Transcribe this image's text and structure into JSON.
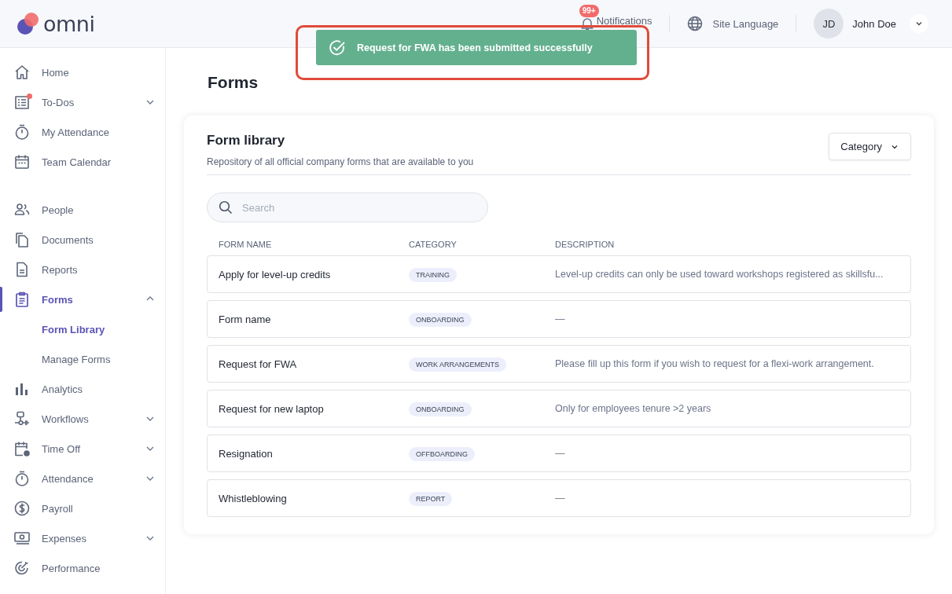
{
  "header": {
    "logo": "omni",
    "notifications": {
      "label": "Notifications",
      "badge": "99+"
    },
    "language": "Site Language",
    "user": {
      "initials": "JD",
      "name": "John Doe"
    }
  },
  "toast": {
    "message": "Request for FWA has been submitted successfully",
    "highlighted": true
  },
  "sidebar": {
    "groups": [
      [
        {
          "label": "Home",
          "selected": false,
          "expandable": false
        },
        {
          "label": "To-Dos",
          "selected": false,
          "expandable": true,
          "expanded": false,
          "alert": true
        },
        {
          "label": "My Attendance",
          "selected": false,
          "expandable": false
        },
        {
          "label": "Team Calendar",
          "selected": false,
          "expandable": false
        }
      ],
      [
        {
          "label": "People",
          "selected": false,
          "expandable": false
        },
        {
          "label": "Documents",
          "selected": false,
          "expandable": false
        },
        {
          "label": "Reports",
          "selected": false,
          "expandable": false
        },
        {
          "label": "Forms",
          "selected": true,
          "expandable": true,
          "expanded": true,
          "children": [
            {
              "label": "Form Library",
              "selected": true
            },
            {
              "label": "Manage Forms",
              "selected": false
            }
          ]
        },
        {
          "label": "Analytics",
          "selected": false,
          "expandable": false
        },
        {
          "label": "Workflows",
          "selected": false,
          "expandable": true,
          "expanded": false
        },
        {
          "label": "Time Off",
          "selected": false,
          "expandable": true,
          "expanded": false
        },
        {
          "label": "Attendance",
          "selected": false,
          "expandable": true,
          "expanded": false
        },
        {
          "label": "Payroll",
          "selected": false,
          "expandable": false
        },
        {
          "label": "Expenses",
          "selected": false,
          "expandable": true,
          "expanded": false
        },
        {
          "label": "Performance",
          "selected": false,
          "expandable": false
        }
      ]
    ]
  },
  "page_title": "Forms",
  "card": {
    "title": "Form library",
    "subtitle": "Repository of all official company forms that are available to you",
    "filter": "Category",
    "search": {
      "placeholder": "Search"
    },
    "table": {
      "columns": [
        "FORM NAME",
        "CATEGORY",
        "DESCRIPTION"
      ],
      "rows": [
        {
          "name": "Apply for level-up credits",
          "category": "TRAINING",
          "description": "Level-up credits can only be used toward workshops registered as skillsfu..."
        },
        {
          "name": "Form name",
          "category": "ONBOARDING",
          "description": "—"
        },
        {
          "name": "Request for FWA",
          "category": "WORK ARRANGEMENTS",
          "description": "Please fill up this form if you wish to request for a flexi-work arrangement."
        },
        {
          "name": "Request for new laptop",
          "category": "ONBOARDING",
          "description": "Only for employees tenure >2 years"
        },
        {
          "name": "Resignation",
          "category": "OFFBOARDING",
          "description": "—"
        },
        {
          "name": "Whistleblowing",
          "category": "REPORT",
          "description": "—"
        }
      ]
    }
  }
}
